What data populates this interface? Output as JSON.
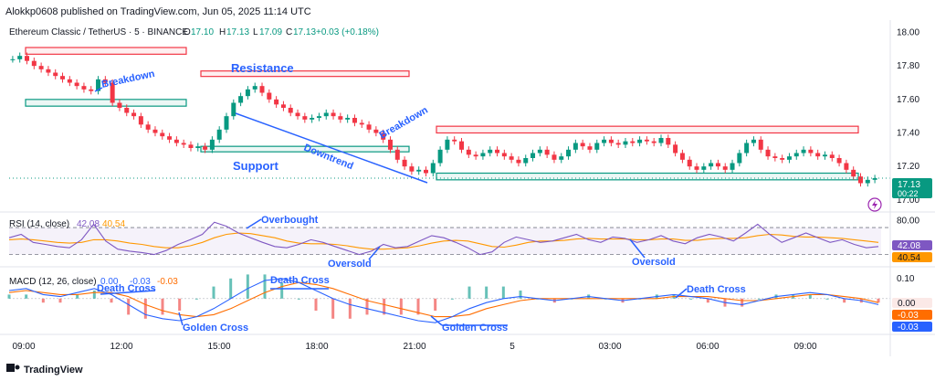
{
  "header": {
    "publisher": "Alokkp0608 published on TradingView.com, Jun 05, 2025 11:14 UTC"
  },
  "symbol": {
    "name": "Ethereum Classic / TetherUS · 5 · BINANCE",
    "o_label": "O",
    "o_value": "17.10",
    "h_label": "H",
    "h_value": "17.13",
    "l_label": "L",
    "l_value": "17.09",
    "c_label": "C",
    "c_value": "17.13",
    "change": "+0.03 (+0.18%)"
  },
  "price_badge": {
    "value": "17.13",
    "countdown": "00:22"
  },
  "rsi": {
    "title": "RSI (14, close)",
    "v1": "42.08",
    "v2": "40.54"
  },
  "macd": {
    "title": "MACD (12, 26, close)",
    "v1": "0.00",
    "v2": "-0.03",
    "v3": "-0.03"
  },
  "annotations": {
    "resistance": "Resistance",
    "support": "Support",
    "breakdown": "Breakdown",
    "downtrend": "Downtrend",
    "overbought": "Overbought",
    "oversold": "Oversold",
    "death_cross": "Death Cross",
    "golden_cross": "Golden Cross"
  },
  "footer": {
    "brand": "TradingView"
  },
  "colors": {
    "up": "#089981",
    "down": "#f23645",
    "rsi": "#7e57c2",
    "rsi_ma": "#ff9800",
    "macd": "#2962ff",
    "signal": "#ff6d00",
    "annotation": "#2962ff"
  },
  "chart_data": [
    {
      "type": "candlestick",
      "x_ticks": [
        "09:00",
        "12:00",
        "15:00",
        "18:00",
        "21:00",
        "5",
        "03:00",
        "06:00",
        "09:00"
      ],
      "y_ticks": [
        17.0,
        17.2,
        17.4,
        17.6,
        17.8,
        18.0
      ],
      "ylim": [
        16.95,
        18.03
      ],
      "last_price": 17.13,
      "close_series": [
        17.84,
        17.86,
        17.83,
        17.8,
        17.78,
        17.76,
        17.74,
        17.72,
        17.7,
        17.68,
        17.66,
        17.65,
        17.72,
        17.7,
        17.58,
        17.55,
        17.52,
        17.5,
        17.45,
        17.42,
        17.4,
        17.38,
        17.36,
        17.34,
        17.33,
        17.31,
        17.32,
        17.3,
        17.36,
        17.42,
        17.5,
        17.58,
        17.62,
        17.66,
        17.68,
        17.64,
        17.6,
        17.57,
        17.55,
        17.52,
        17.5,
        17.48,
        17.49,
        17.5,
        17.52,
        17.5,
        17.48,
        17.49,
        17.46,
        17.45,
        17.42,
        17.4,
        17.36,
        17.3,
        17.24,
        17.2,
        17.17,
        17.18,
        17.16,
        17.22,
        17.3,
        17.36,
        17.35,
        17.3,
        17.27,
        17.26,
        17.28,
        17.3,
        17.28,
        17.26,
        17.24,
        17.22,
        17.25,
        17.28,
        17.3,
        17.27,
        17.24,
        17.26,
        17.3,
        17.34,
        17.32,
        17.3,
        17.34,
        17.36,
        17.34,
        17.33,
        17.35,
        17.34,
        17.36,
        17.35,
        17.34,
        17.37,
        17.33,
        17.28,
        17.24,
        17.2,
        17.18,
        17.2,
        17.22,
        17.2,
        17.18,
        17.22,
        17.28,
        17.34,
        17.36,
        17.3,
        17.26,
        17.25,
        17.24,
        17.26,
        17.28,
        17.3,
        17.28,
        17.26,
        17.27,
        17.25,
        17.22,
        17.18,
        17.14,
        17.1,
        17.12,
        17.13
      ],
      "zones": [
        {
          "kind": "resistance",
          "low": 17.87,
          "high": 17.91
        },
        {
          "kind": "resistance",
          "low": 17.74,
          "high": 17.77
        },
        {
          "kind": "resistance",
          "low": 17.4,
          "high": 17.44
        },
        {
          "kind": "support",
          "low": 17.56,
          "high": 17.6
        },
        {
          "kind": "support",
          "low": 17.29,
          "high": 17.32
        },
        {
          "kind": "support",
          "low": 17.12,
          "high": 17.16
        }
      ]
    },
    {
      "type": "line",
      "title": "RSI (14, close)",
      "y_ticks": [
        80.0
      ],
      "ylim": [
        20,
        85
      ],
      "bands": [
        30,
        70
      ],
      "series": [
        {
          "name": "RSI",
          "values": [
            55,
            60,
            48,
            45,
            42,
            40,
            52,
            75,
            50,
            38,
            35,
            33,
            30,
            36,
            45,
            52,
            60,
            78,
            72,
            62,
            55,
            48,
            42,
            40,
            45,
            52,
            48,
            42,
            36,
            30,
            35,
            45,
            40,
            42,
            50,
            58,
            55,
            48,
            40,
            30,
            34,
            48,
            56,
            52,
            48,
            50,
            55,
            60,
            52,
            48,
            56,
            54,
            48,
            52,
            58,
            50,
            46,
            55,
            60,
            56,
            50,
            62,
            75,
            60,
            48,
            55,
            62,
            55,
            48,
            52,
            45,
            40,
            42
          ]
        },
        {
          "name": "MA",
          "values": [
            52,
            53,
            52,
            50,
            48,
            47,
            48,
            52,
            52,
            50,
            47,
            45,
            42,
            40,
            40,
            43,
            48,
            55,
            60,
            62,
            61,
            58,
            55,
            50,
            47,
            46,
            46,
            45,
            43,
            40,
            38,
            38,
            39,
            40,
            43,
            47,
            50,
            51,
            50,
            46,
            42,
            41,
            44,
            48,
            50,
            50,
            51,
            53,
            54,
            53,
            53,
            53,
            52,
            52,
            53,
            53,
            51,
            51,
            53,
            54,
            54,
            55,
            58,
            60,
            59,
            57,
            56,
            56,
            55,
            54,
            52,
            50,
            48
          ]
        }
      ]
    },
    {
      "type": "line",
      "title": "MACD (12, 26, close)",
      "y_ticks": [
        0.1
      ],
      "ylim": [
        -0.16,
        0.14
      ],
      "series": [
        {
          "name": "MACD",
          "values": [
            0.04,
            0.05,
            0.02,
            0.01,
            0.03,
            0.05,
            0.02,
            -0.03,
            -0.08,
            -0.1,
            -0.11,
            -0.09,
            -0.05,
            0.0,
            0.05,
            0.09,
            0.1,
            0.08,
            0.04,
            0.0,
            -0.03,
            -0.05,
            -0.07,
            -0.09,
            -0.11,
            -0.12,
            -0.09,
            -0.05,
            -0.02,
            0.0,
            0.01,
            0.0,
            -0.01,
            0.0,
            0.01,
            0.0,
            -0.01,
            0.0,
            0.01,
            0.02,
            0.01,
            0.0,
            -0.02,
            -0.03,
            -0.01,
            0.01,
            0.02,
            0.03,
            0.02,
            0.0,
            -0.01,
            -0.03
          ]
        },
        {
          "name": "Signal",
          "values": [
            0.03,
            0.04,
            0.03,
            0.02,
            0.02,
            0.03,
            0.03,
            0.01,
            -0.03,
            -0.06,
            -0.08,
            -0.09,
            -0.08,
            -0.05,
            -0.01,
            0.03,
            0.06,
            0.08,
            0.07,
            0.05,
            0.02,
            -0.01,
            -0.03,
            -0.05,
            -0.07,
            -0.09,
            -0.09,
            -0.08,
            -0.05,
            -0.03,
            -0.01,
            0.0,
            0.0,
            0.0,
            0.0,
            0.0,
            0.0,
            0.0,
            0.0,
            0.01,
            0.01,
            0.01,
            0.0,
            -0.01,
            -0.01,
            0.0,
            0.01,
            0.02,
            0.02,
            0.01,
            0.0,
            -0.02
          ]
        }
      ]
    }
  ]
}
